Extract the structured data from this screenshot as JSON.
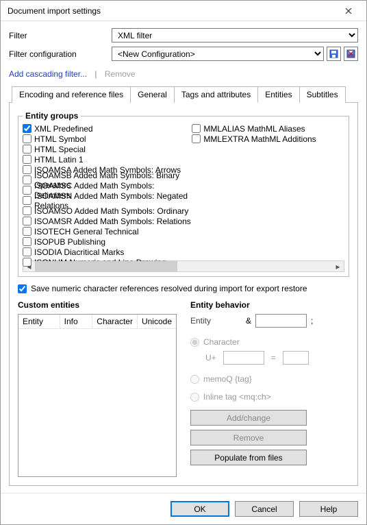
{
  "window": {
    "title": "Document import settings"
  },
  "filter": {
    "label": "Filter",
    "selected": "XML filter",
    "config_label": "Filter configuration",
    "config_selected": "<New Configuration>"
  },
  "links": {
    "add_cascading": "Add cascading filter...",
    "remove": "Remove"
  },
  "tabs": [
    "Encoding and reference files",
    "General",
    "Tags and attributes",
    "Entities",
    "Subtitles"
  ],
  "entity_groups": {
    "legend": "Entity groups",
    "left": [
      {
        "label": "XML Predefined",
        "checked": true
      },
      {
        "label": "HTML Symbol",
        "checked": false
      },
      {
        "label": "HTML Special",
        "checked": false
      },
      {
        "label": "HTML Latin 1",
        "checked": false
      },
      {
        "label": "ISOAMSA Added Math Symbols: Arrows",
        "checked": false
      },
      {
        "label": "ISOAMSB Added Math Symbols: Binary Operators",
        "checked": false
      },
      {
        "label": "ISOAMSC Added Math Symbols: Delimiters",
        "checked": false
      },
      {
        "label": "ISOAMSN Added Math Symbols: Negated Relations",
        "checked": false
      },
      {
        "label": "ISOAMSO Added Math Symbols: Ordinary",
        "checked": false
      },
      {
        "label": "ISOAMSR Added Math Symbols: Relations",
        "checked": false
      },
      {
        "label": "ISOTECH General Technical",
        "checked": false
      },
      {
        "label": "ISOPUB Publishing",
        "checked": false
      },
      {
        "label": "ISODIA Diacritical Marks",
        "checked": false
      },
      {
        "label": "ISONUM Numeric and Line Drawing",
        "checked": false
      }
    ],
    "right": [
      {
        "label": "MMLALIAS MathML Aliases",
        "checked": false
      },
      {
        "label": "MMLEXTRA MathML Additions",
        "checked": false
      }
    ]
  },
  "save_numeric": {
    "label": "Save numeric character references resolved during import for export restore",
    "checked": true
  },
  "custom": {
    "title": "Custom entities",
    "headers": [
      "Entity",
      "Info",
      "Character",
      "Unicode"
    ]
  },
  "behavior": {
    "title": "Entity behavior",
    "entity_label": "Entity",
    "entity_value": "",
    "amp": "&",
    "semicolon": ";",
    "radio_character": "Character",
    "u_prefix": "U+",
    "u_value": "",
    "equals": "=",
    "eq_value": "",
    "radio_memoq": "memoQ {tag}",
    "radio_inline": "Inline tag <mq:ch>",
    "btn_add": "Add/change",
    "btn_remove": "Remove",
    "btn_populate": "Populate from files"
  },
  "footer": {
    "ok": "OK",
    "cancel": "Cancel",
    "help": "Help"
  }
}
